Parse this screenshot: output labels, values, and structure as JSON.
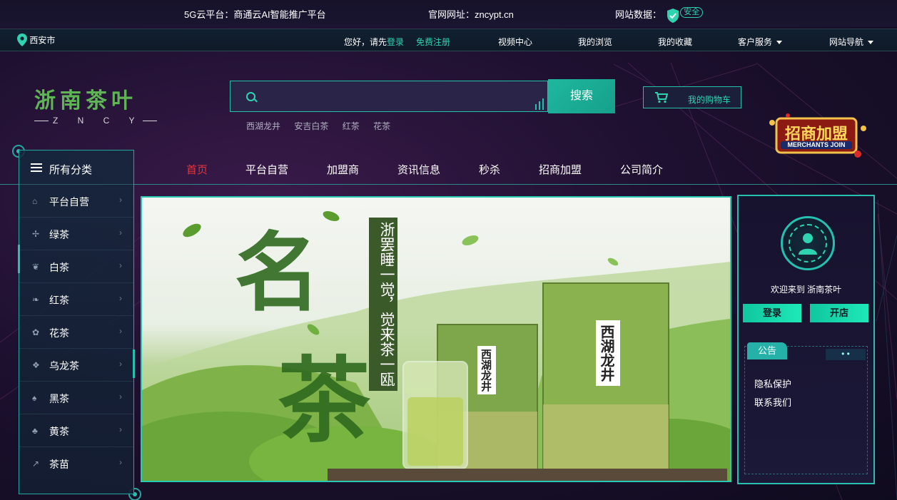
{
  "topbar": {
    "platform": "5G云平台：商通云AI智能推广平台",
    "website": "官网网址：zncypt.cn",
    "data_label": "网站数据：",
    "safe": "安全"
  },
  "subbar": {
    "location": "西安市",
    "greeting": "您好，请先",
    "login": "登录",
    "register": "免费注册",
    "video": "视频中心",
    "browse": "我的浏览",
    "favorites": "我的收藏",
    "service": "客户服务",
    "sitenav": "网站导航"
  },
  "logo": {
    "title": "浙南茶叶",
    "sub": "Z N C Y"
  },
  "search": {
    "placeholder": "",
    "button": "搜索",
    "hot": [
      "西湖龙井",
      "安吉白茶",
      "红茶",
      "花茶"
    ]
  },
  "cart": {
    "label": "我的购物车"
  },
  "merchant": {
    "cn": "招商加盟",
    "en": "MERCHANTS JOIN"
  },
  "mainnav": [
    "首页",
    "平台自营",
    "加盟商",
    "资讯信息",
    "秒杀",
    "招商加盟",
    "公司简介"
  ],
  "sidebar": {
    "head": "所有分类",
    "items": [
      "平台自营",
      "绿茶",
      "白茶",
      "红茶",
      "花茶",
      "乌龙茶",
      "黑茶",
      "黄茶",
      "茶苗"
    ]
  },
  "banner": {
    "big1": "名",
    "big2": "茶",
    "poem": "浙罢睡一觉，觉来茶一瓯",
    "box1": "西湖龙井",
    "box2": "西湖龙井"
  },
  "rpanel": {
    "welcome": "欢迎来到 浙南茶叶",
    "login": "登录",
    "open": "开店",
    "notice": "公告",
    "links": [
      "隐私保护",
      "联系我们"
    ]
  },
  "colors": {
    "accent": "#25c0b0",
    "active": "#e8343a",
    "green": "#5fb456"
  }
}
